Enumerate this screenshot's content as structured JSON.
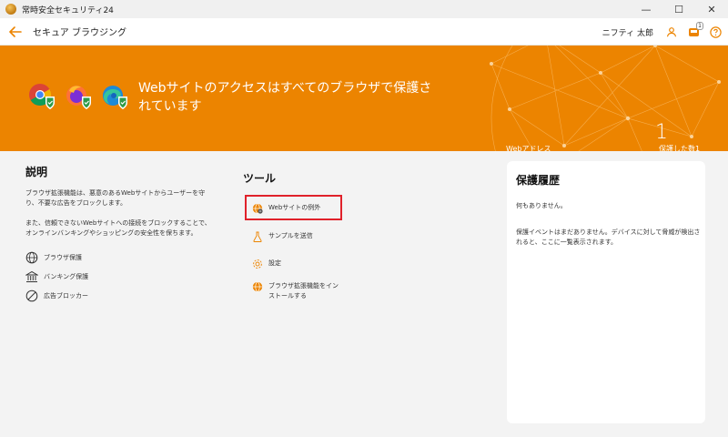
{
  "window": {
    "title": "常時安全セキュリティ24",
    "minimize": "—",
    "maximize": "☐",
    "close": "✕"
  },
  "header": {
    "title": "セキュア ブラウジング",
    "user_name": "ニフティ 太郎",
    "notification_count": "1"
  },
  "banner": {
    "message": "Webサイトのアクセスはすべてのブラウザで保護されています",
    "web_address_label": "Webアドレス",
    "protected_count": "1",
    "protected_label": "保護した数1",
    "browsers": [
      "chrome-icon",
      "firefox-icon",
      "edge-icon"
    ]
  },
  "description": {
    "title": "説明",
    "paragraph1": "ブラウザ拡張機能は、悪意のあるWebサイトからユーザーを守り、不要な広告をブロックします。",
    "paragraph2": "また、信頼できないWebサイトへの接続をブロックすることで、オンラインバンキングやショッピングの安全性を保ちます。",
    "features": [
      "ブラウザ保護",
      "バンキング保護",
      "広告ブロッカー"
    ]
  },
  "tools": {
    "title": "ツール",
    "items": [
      "Webサイトの例外",
      "サンプルを送信",
      "設定",
      "ブラウザ拡張機能をインストールする"
    ]
  },
  "history": {
    "title": "保護履歴",
    "empty": "何もありません。",
    "info": "保護イベントはまだありません。デバイスに対して脅威が検出されると、ここに一覧表示されます。"
  },
  "colors": {
    "accent": "#ec8400",
    "highlight": "#e0212a"
  }
}
